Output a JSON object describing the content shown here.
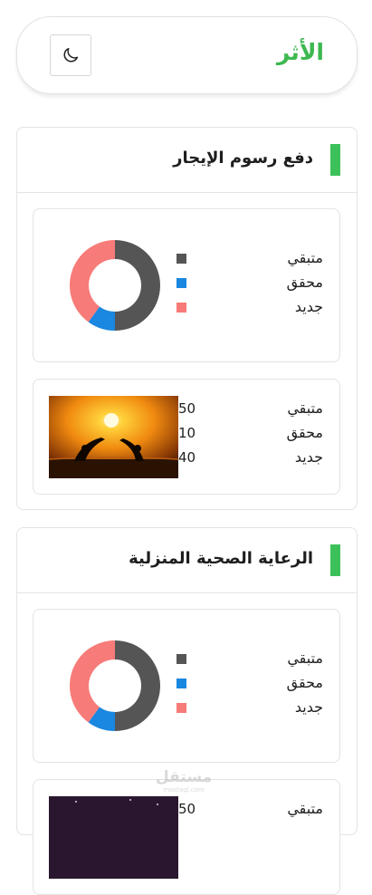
{
  "header": {
    "logo_text": "الأثر",
    "theme_toggle_icon": "moon-icon"
  },
  "legend_colors": {
    "remaining": "#555555",
    "achieved": "#1a87e0",
    "new": "#f77b78"
  },
  "cards": [
    {
      "title": "دفع رسوم الإيجار",
      "legend": {
        "remaining": "متبقي",
        "achieved": "محقق",
        "new": "جديد"
      },
      "stats": [
        {
          "label": "متبقي",
          "value": "50"
        },
        {
          "label": "محقق",
          "value": "10"
        },
        {
          "label": "جديد",
          "value": "40"
        }
      ]
    },
    {
      "title": "الرعاية الصحية المنزلية",
      "legend": {
        "remaining": "متبقي",
        "achieved": "محقق",
        "new": "جديد"
      },
      "stats": [
        {
          "label": "متبقي",
          "value": "50"
        }
      ]
    }
  ],
  "chart_data": [
    {
      "type": "pie",
      "categories": [
        "متبقي",
        "محقق",
        "جديد"
      ],
      "values": [
        50,
        10,
        40
      ]
    },
    {
      "type": "pie",
      "categories": [
        "متبقي",
        "محقق",
        "جديد"
      ],
      "values": [
        50,
        10,
        40
      ]
    }
  ],
  "watermark": {
    "text": "مستقل",
    "sub": "mostaql.com"
  }
}
